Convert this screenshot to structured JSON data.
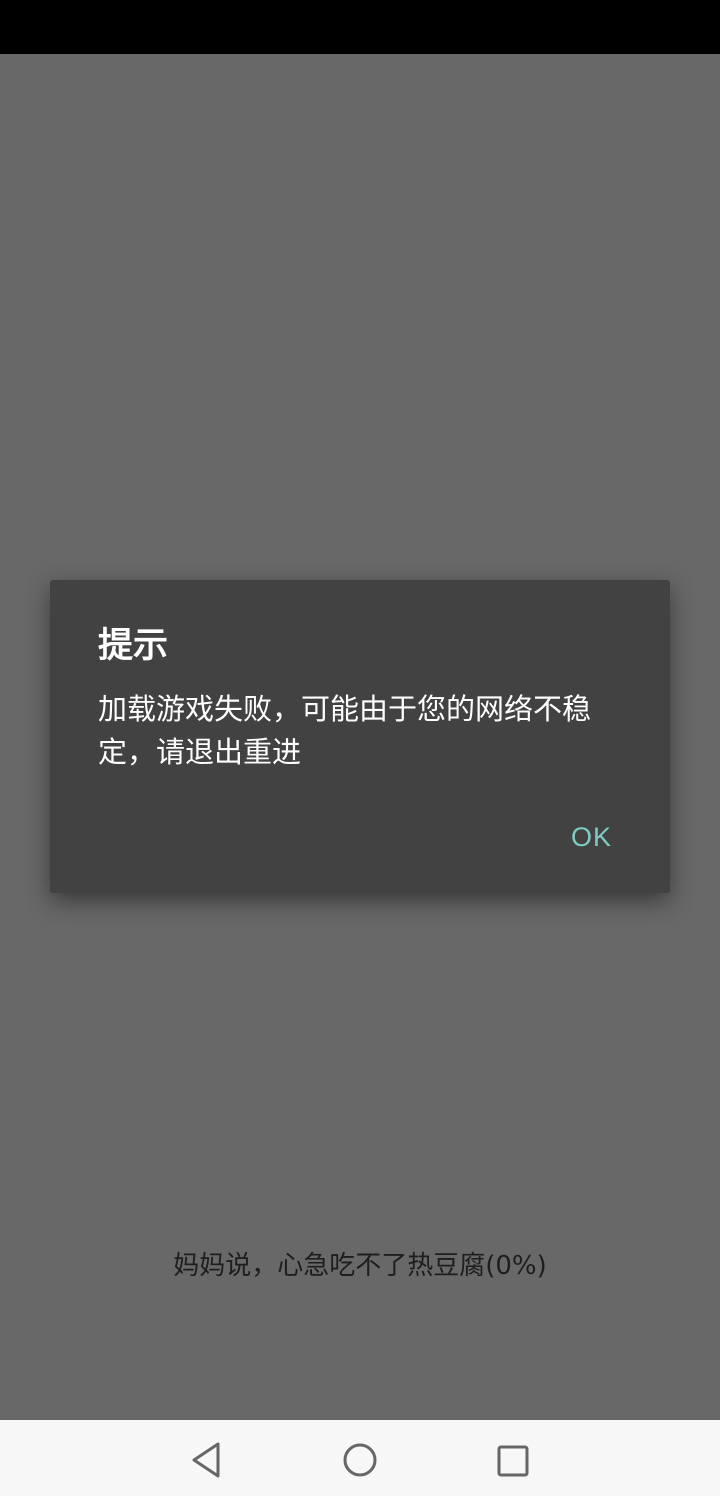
{
  "dialog": {
    "title": "提示",
    "message": "加载游戏失败，可能由于您的网络不稳定，请退出重进",
    "ok_label": "OK",
    "ok_color": "#7fcbc4"
  },
  "loading": {
    "text": "妈妈说，心急吃不了热豆腐(0%)",
    "progress_percent": 0
  },
  "nav_bar": {
    "icons": [
      "back-triangle-icon",
      "home-circle-icon",
      "recents-square-icon"
    ]
  }
}
